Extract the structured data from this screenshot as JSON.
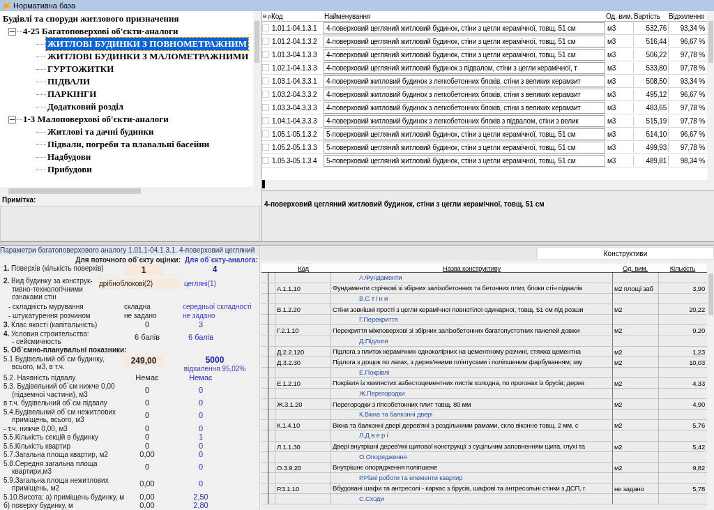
{
  "window": {
    "title": "Нормативна база"
  },
  "tree": {
    "label": "Будівлі та споруди житлового призначення",
    "children": [
      {
        "label": "4-25 Багатоповерхові об'єкти-аналоги",
        "expanded": true,
        "children": [
          {
            "label": "ЖИТЛОВІ БУДИНКИ З ПОВНОМЕТРАЖНИМ",
            "selected": true
          },
          {
            "label": "ЖИТЛОВІ БУДИНКИ З МАЛОМЕТРАЖНИМИ",
            "selected": false
          },
          {
            "label": "ГУРТОЖИТКИ",
            "selected": false
          },
          {
            "label": "ПІДВАЛИ",
            "selected": false
          },
          {
            "label": "ПАРКІНГИ",
            "selected": false
          },
          {
            "label": "Додатковий розділ",
            "selected": false
          }
        ]
      },
      {
        "label": "1-3 Малоповерхові об'єкти-аналоги",
        "expanded": true,
        "children": [
          {
            "label": "Житлові та дачні будинки",
            "selected": false
          },
          {
            "label": "Підвали, погреби та плавальні басейни",
            "selected": false
          },
          {
            "label": "Надбудови",
            "selected": false
          },
          {
            "label": "Прибудови",
            "selected": false
          }
        ]
      }
    ]
  },
  "note": {
    "label": "Примітка:"
  },
  "analogs": {
    "columns": [
      "В р",
      "Код",
      "Найменування",
      "Од. вим.",
      "Вартість",
      "Відхилення"
    ],
    "rows": [
      {
        "checked": false,
        "code": "1.01.1-04.1.3.1",
        "name": "4-поверховий цегляний житловий будинок, стіни з цегли керамічної, товщ. 51 см",
        "unit": "м3",
        "cost": "532,76",
        "deviation": "93,34 %"
      },
      {
        "checked": false,
        "code": "1.01.2-04.1.3.2",
        "name": "4-поверховий цегляний житловий будинок, стіни з цегли керамічної, товщ. 51 см",
        "unit": "м3",
        "cost": "516,44",
        "deviation": "96,67 %"
      },
      {
        "checked": false,
        "code": "1.01.3-04.1.3.3",
        "name": "4-поверховий цегляний житловий будинок, стіни з цегли керамічної, товщ. 51 см",
        "unit": "м3",
        "cost": "506,22",
        "deviation": "97,78 %"
      },
      {
        "checked": false,
        "code": "1.02.1-04.1.3.3",
        "name": "4-поверховий цегляний житловий будинок з підвалом, стіни з цегли керамічної, т",
        "unit": "м3",
        "cost": "533,80",
        "deviation": "97,78 %"
      },
      {
        "checked": false,
        "code": "1.03.1-04.3.3.1",
        "name": "4-поверховий житловий будинок з легкобетонних блоків, стіни з великих керамзит",
        "unit": "м3",
        "cost": "508,50",
        "deviation": "93,34 %"
      },
      {
        "checked": false,
        "code": "1.03.2-04.3.3.2",
        "name": "4-поверховий житловий будинок з легкобетонних блоків, стіни з великих керамзит",
        "unit": "м3",
        "cost": "495,12",
        "deviation": "96,67 %"
      },
      {
        "checked": false,
        "code": "1.03.3-04.3.3.3",
        "name": "4-поверховий житловий будинок з легкобетонних блоків, стіни з великих керамзит",
        "unit": "м3",
        "cost": "483,65",
        "deviation": "97,78 %"
      },
      {
        "checked": false,
        "code": "1.04.1-04.3.3.3",
        "name": "4-поверховий житловий будинок з легкобетонних блоків з підвалом, стіни з велик",
        "unit": "м3",
        "cost": "515,19",
        "deviation": "97,78 %"
      },
      {
        "checked": false,
        "code": "1.05.1-05.1.3.2",
        "name": "5-поверховий цегляний житловий будинок, стіни з цегли керамічної, товщ. 51 см",
        "unit": "м3",
        "cost": "514,10",
        "deviation": "96,67 %"
      },
      {
        "checked": false,
        "code": "1.05.2-05.1.3.3",
        "name": "5-поверховий цегляний житловий будинок, стіни з цегли керамічної, товщ. 51 см",
        "unit": "м3",
        "cost": "499,93",
        "deviation": "97,78 %"
      },
      {
        "checked": false,
        "code": "1.05.3-05.1.3.4",
        "name": "5-поверховий цегляний житловий будинок, стіни з цегли керамічної, товщ. 51 см",
        "unit": "м3",
        "cost": "489,81",
        "deviation": "98,34 %"
      }
    ]
  },
  "description": "4-поверховий цегляний житловий будинок, стіни з цегли керамічної, товщ. 51 см",
  "params": {
    "title": "Параметри багатоповерхового аналогу 1.01.1-04.1.3.1. 4-поверховий цегляний",
    "col_current": "Для поточного об`єкту оцінки:",
    "col_analog": "Для об`єкту-аналога:",
    "rows": [
      {
        "kind": "field",
        "lines": [
          "**1.** Поверхів (кількість поверхів)"
        ],
        "current": "1",
        "analog": "4"
      },
      {
        "kind": "field-text",
        "lines": [
          "**2.** Вид будинку за конструк-",
          "тивно-технологічними",
          "ознаками стін"
        ],
        "current": "дрібноблокові(2)",
        "analog": "цегляні(1)"
      },
      {
        "kind": "text",
        "lines": [
          "- складність мурування"
        ],
        "current": "складна",
        "analog": "середньої складності"
      },
      {
        "kind": "text",
        "lines": [
          "- штукатурення розчином"
        ],
        "current": "не задано",
        "analog": "не задано"
      },
      {
        "kind": "value",
        "lines": [
          "**3.** Клас якості (капітальність)"
        ],
        "current": "0",
        "analog": "3"
      },
      {
        "kind": "value",
        "lines": [
          "**4.** Условия строительства:",
          "- сейсмичность"
        ],
        "current": "6 балів",
        "analog": "6 балів"
      },
      {
        "kind": "heading",
        "lines": [
          "5. Об`ємно-планувальні показники:"
        ]
      },
      {
        "kind": "field",
        "lines": [
          "5.1 Будівельний об`єм будинку,",
          "всього, м3, в т.ч."
        ],
        "current": "249,00",
        "analog": "5000",
        "analog_note": "відхилення 95,02%"
      },
      {
        "kind": "value",
        "lines": [
          "5.2. Наявність підвалу"
        ],
        "current": "Немає",
        "analog": "Немає"
      },
      {
        "kind": "value",
        "lines": [
          "5.3. Будівельний об`єм нижче 0,00",
          "(підземної частини), м3"
        ],
        "current": "0",
        "analog": "0"
      },
      {
        "kind": "value",
        "lines": [
          "в т.ч. будівельний об`єм підвалу"
        ],
        "current": "0",
        "analog": "0"
      },
      {
        "kind": "value",
        "lines": [
          "5.4.Будівельний об`єм нежитлових",
          "приміщень, всього, м3"
        ],
        "current": "0",
        "analog": "0"
      },
      {
        "kind": "value",
        "lines": [
          "- т.ч. нижче 0,00, м3"
        ],
        "current": "0",
        "analog": "0"
      },
      {
        "kind": "value",
        "lines": [
          "5.5.Кількість секцій в будинку"
        ],
        "current": "0",
        "analog": "1"
      },
      {
        "kind": "value",
        "lines": [
          "5.6.Кількість квартир"
        ],
        "current": "0",
        "analog": "0"
      },
      {
        "kind": "value",
        "lines": [
          "5.7.Загальна площа квартир, м2"
        ],
        "current": "0,00",
        "analog": "0"
      },
      {
        "kind": "value",
        "lines": [
          "5.8.Середня загальна площа",
          "квартири,м3"
        ],
        "current": "0",
        "analog": "0"
      },
      {
        "kind": "value",
        "lines": [
          "5.9.Загальна площа нежитлових",
          "приміщень, м2"
        ],
        "current": "0,00",
        "analog": "0"
      },
      {
        "kind": "value",
        "lines": [
          "5.10.Висота: а) приміщень будинку, м"
        ],
        "current": "0,00",
        "analog": "2,50"
      },
      {
        "kind": "value",
        "lines": [
          "б) поверху будинку, м"
        ],
        "current": "0,00",
        "analog": "2,80"
      }
    ]
  },
  "tabs": [
    {
      "selected": false
    },
    {
      "label": "Конструктиви",
      "selected": true
    }
  ],
  "constructs": {
    "columns": [
      "Код",
      "Назва конструктиву",
      "Од. вим.",
      "Кількість"
    ],
    "rows": [
      {
        "kind": "section",
        "name": "А.Фундаменти"
      },
      {
        "kind": "item",
        "code": "А.1.1.10",
        "name": "Фундаменти стрічкові зі збірних залізобетонних та бетонних плит, блоки стін підвалів",
        "unit": "м2 площі заб",
        "qty": "3,90"
      },
      {
        "kind": "section",
        "name": "В.С т і н и"
      },
      {
        "kind": "item",
        "code": "В.1.2.20",
        "name": "Стіни зовнішні прості з цегли керамічної повнотілої одинарної, товщ. 51 см під розши",
        "unit": "м2",
        "qty": "20,22"
      },
      {
        "kind": "section",
        "name": "Г.Перекриття"
      },
      {
        "kind": "item",
        "code": "Г.2.1.10",
        "name": "Перекриття міжповерхові зі збірних залізобетонних багатопустотних панелей довжи",
        "unit": "м2",
        "qty": "9,20"
      },
      {
        "kind": "section",
        "name": "Д.Підлоги"
      },
      {
        "kind": "item",
        "code": "Д.2.2.120",
        "name": "Підлога з плиток керамічних одноколірних на цементному розчині, стяжка цементна",
        "unit": "м2",
        "qty": "1,23"
      },
      {
        "kind": "item",
        "code": "Д.3.2.30",
        "name": "Підлога з дощок по лагах, з дерев'яними плінтусами і поліпшеним фарбуванням; зву",
        "unit": "м2",
        "qty": "10,03"
      },
      {
        "kind": "section",
        "name": "Е.Покрівлі"
      },
      {
        "kind": "item",
        "code": "Е.1.2.10",
        "name": "Покрівля із хвилястих азбестоцементних листів холодна, по прогонах із брусів; дерев",
        "unit": "м2",
        "qty": "4,33"
      },
      {
        "kind": "section",
        "name": "Ж.Перегородки"
      },
      {
        "kind": "item",
        "code": "Ж.3.1.20",
        "name": "Перегородки з гіпсобетонних плит товщ. 80 мм",
        "unit": "м2",
        "qty": "4,90"
      },
      {
        "kind": "section",
        "name": "К.Вікна та балконні двері"
      },
      {
        "kind": "item",
        "code": "К.1.4.10",
        "name": "Вікна та балконні двері дерев'яні з роздільними рамами, скло віконне товщ. 2 мм, с",
        "unit": "м2",
        "qty": "5,76"
      },
      {
        "kind": "section",
        "name": "Л.Д в е р і"
      },
      {
        "kind": "item",
        "code": "Л.1.1.30",
        "name": "Двері внутрішні дерев'яні щитової конструкції з суцільним заповненням щита, глухі та",
        "unit": "м2",
        "qty": "5,42"
      },
      {
        "kind": "section",
        "name": "О.Опорядження"
      },
      {
        "kind": "item",
        "code": "О.3.9.20",
        "name": "Внутрішнє опорядження поліпшене",
        "unit": "м2",
        "qty": "9,82"
      },
      {
        "kind": "section",
        "name": "Р.Різні роботи та елементи квартир"
      },
      {
        "kind": "item",
        "code": "Р.3.1.10",
        "name": "Вбудовані шафи та антресолі - каркас з брусів, шафові та антресольні стінки з ДСП, г",
        "unit": "не задано",
        "qty": "5,78"
      },
      {
        "kind": "section",
        "name": "С.Сходи"
      }
    ]
  }
}
